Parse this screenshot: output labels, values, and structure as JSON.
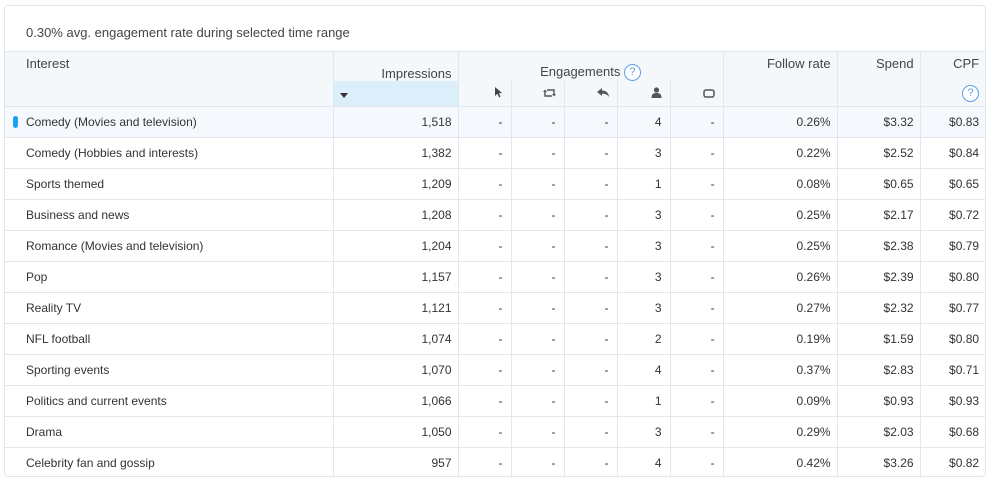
{
  "summary": "0.30% avg. engagement rate during selected time range",
  "headers": {
    "interest": "Interest",
    "impressions": "Impressions",
    "engagements": "Engagements",
    "follow_rate": "Follow rate",
    "spend": "Spend",
    "cpf": "CPF",
    "hint": "?"
  },
  "icons": {
    "engagement_columns": [
      "cursor-icon",
      "retweet-icon",
      "reply-icon",
      "follow-user-icon",
      "card-icon"
    ]
  },
  "colors": {
    "accent": "#1da1f2",
    "hint": "#5e9ee7",
    "sorted_column": "#dbeef9"
  },
  "rows": [
    {
      "interest": "Comedy (Movies and television)",
      "impressions": "1,518",
      "clicks": "-",
      "retweets": "-",
      "replies": "-",
      "follows": "4",
      "cards": "-",
      "follow_rate": "0.26%",
      "spend": "$3.32",
      "cpf": "$0.83"
    },
    {
      "interest": "Comedy (Hobbies and interests)",
      "impressions": "1,382",
      "clicks": "-",
      "retweets": "-",
      "replies": "-",
      "follows": "3",
      "cards": "-",
      "follow_rate": "0.22%",
      "spend": "$2.52",
      "cpf": "$0.84"
    },
    {
      "interest": "Sports themed",
      "impressions": "1,209",
      "clicks": "-",
      "retweets": "-",
      "replies": "-",
      "follows": "1",
      "cards": "-",
      "follow_rate": "0.08%",
      "spend": "$0.65",
      "cpf": "$0.65"
    },
    {
      "interest": "Business and news",
      "impressions": "1,208",
      "clicks": "-",
      "retweets": "-",
      "replies": "-",
      "follows": "3",
      "cards": "-",
      "follow_rate": "0.25%",
      "spend": "$2.17",
      "cpf": "$0.72"
    },
    {
      "interest": "Romance (Movies and television)",
      "impressions": "1,204",
      "clicks": "-",
      "retweets": "-",
      "replies": "-",
      "follows": "3",
      "cards": "-",
      "follow_rate": "0.25%",
      "spend": "$2.38",
      "cpf": "$0.79"
    },
    {
      "interest": "Pop",
      "impressions": "1,157",
      "clicks": "-",
      "retweets": "-",
      "replies": "-",
      "follows": "3",
      "cards": "-",
      "follow_rate": "0.26%",
      "spend": "$2.39",
      "cpf": "$0.80"
    },
    {
      "interest": "Reality TV",
      "impressions": "1,121",
      "clicks": "-",
      "retweets": "-",
      "replies": "-",
      "follows": "3",
      "cards": "-",
      "follow_rate": "0.27%",
      "spend": "$2.32",
      "cpf": "$0.77"
    },
    {
      "interest": "NFL football",
      "impressions": "1,074",
      "clicks": "-",
      "retweets": "-",
      "replies": "-",
      "follows": "2",
      "cards": "-",
      "follow_rate": "0.19%",
      "spend": "$1.59",
      "cpf": "$0.80"
    },
    {
      "interest": "Sporting events",
      "impressions": "1,070",
      "clicks": "-",
      "retweets": "-",
      "replies": "-",
      "follows": "4",
      "cards": "-",
      "follow_rate": "0.37%",
      "spend": "$2.83",
      "cpf": "$0.71"
    },
    {
      "interest": "Politics and current events",
      "impressions": "1,066",
      "clicks": "-",
      "retweets": "-",
      "replies": "-",
      "follows": "1",
      "cards": "-",
      "follow_rate": "0.09%",
      "spend": "$0.93",
      "cpf": "$0.93"
    },
    {
      "interest": "Drama",
      "impressions": "1,050",
      "clicks": "-",
      "retweets": "-",
      "replies": "-",
      "follows": "3",
      "cards": "-",
      "follow_rate": "0.29%",
      "spend": "$2.03",
      "cpf": "$0.68"
    },
    {
      "interest": "Celebrity fan and gossip",
      "impressions": "957",
      "clicks": "-",
      "retweets": "-",
      "replies": "-",
      "follows": "4",
      "cards": "-",
      "follow_rate": "0.42%",
      "spend": "$3.26",
      "cpf": "$0.82"
    }
  ]
}
